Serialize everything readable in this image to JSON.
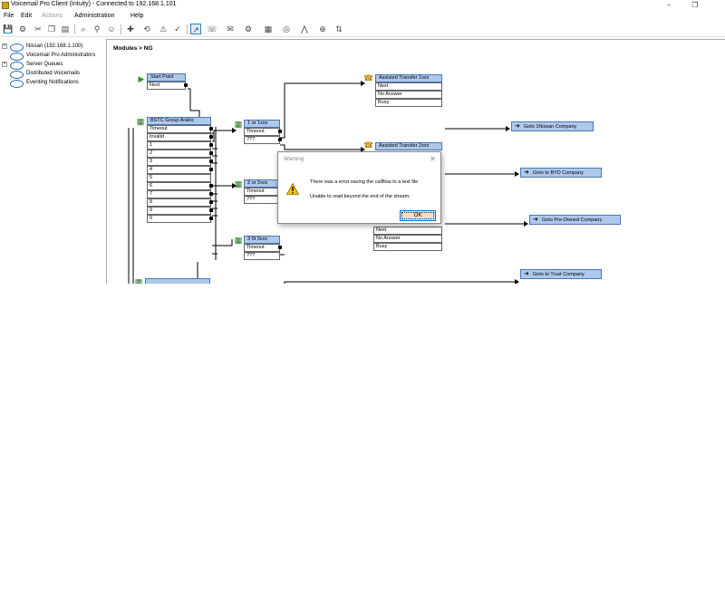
{
  "window": {
    "title": "Voicemail Pro Client (Intuity) - Connected to 192.168.1.101",
    "minimize_icon": "–",
    "restore_icon": "❐"
  },
  "menu": [
    {
      "label": "File",
      "disabled": false
    },
    {
      "label": "Edit",
      "disabled": false
    },
    {
      "label": "Actions",
      "disabled": true
    },
    {
      "label": "Administration",
      "disabled": false
    },
    {
      "label": "Help",
      "disabled": false
    }
  ],
  "tree": {
    "items": [
      {
        "label": "Nissan (192.168.1.100)",
        "expander": "+"
      },
      {
        "label": "Voicemail Pro Administrators",
        "expander": ""
      },
      {
        "label": "Server Queues",
        "expander": "+"
      },
      {
        "label": "Distributed Voicemails",
        "expander": ""
      },
      {
        "label": "Eventing Notifications",
        "expander": ""
      }
    ]
  },
  "breadcrumb": "Modules > NG",
  "nodes": {
    "start": {
      "title": "Start Point",
      "rows": [
        "Next"
      ]
    },
    "bstc": {
      "title": "BSTC Group Arabic",
      "rows": [
        "Timeout",
        "Invalid",
        "1",
        "2",
        "3",
        "4",
        "5",
        "6",
        "7",
        "8",
        "9",
        "0"
      ]
    },
    "n1": {
      "title": "1 or 1xxx",
      "rows": [
        "Timeout",
        "???"
      ]
    },
    "n2": {
      "title": "2 or 2xxx",
      "rows": [
        "Timeout",
        "???"
      ]
    },
    "n3": {
      "title": "3 0t 3xxx",
      "rows": [
        "Timeout",
        "???"
      ]
    },
    "at1": {
      "title": "Assisted Transfer 1xxx",
      "rows": [
        "Next",
        "No Answer",
        "Busy"
      ]
    },
    "at2": {
      "title": "Assisted Transfer 2xxx",
      "rows": []
    },
    "at3": {
      "title": "",
      "rows": [
        "Next",
        "No Answer",
        "Busy"
      ]
    }
  },
  "gotos": [
    {
      "label": "Goto 1Nissan Company"
    },
    {
      "label": "Goto to BYD Company"
    },
    {
      "label": "Goto Pre-Owned Company"
    },
    {
      "label": "Goto to Trust Company"
    }
  ],
  "dialog": {
    "title": "Warning",
    "close": "✕",
    "message": "There was a error saving the callflow to a text file",
    "detail": "Unable to read beyond the end of the stream.",
    "ok_label": "OK"
  },
  "colors": {
    "node_header": "#aec8ec",
    "node_border": "#4a78b4",
    "warning_yellow": "#f7c600"
  }
}
